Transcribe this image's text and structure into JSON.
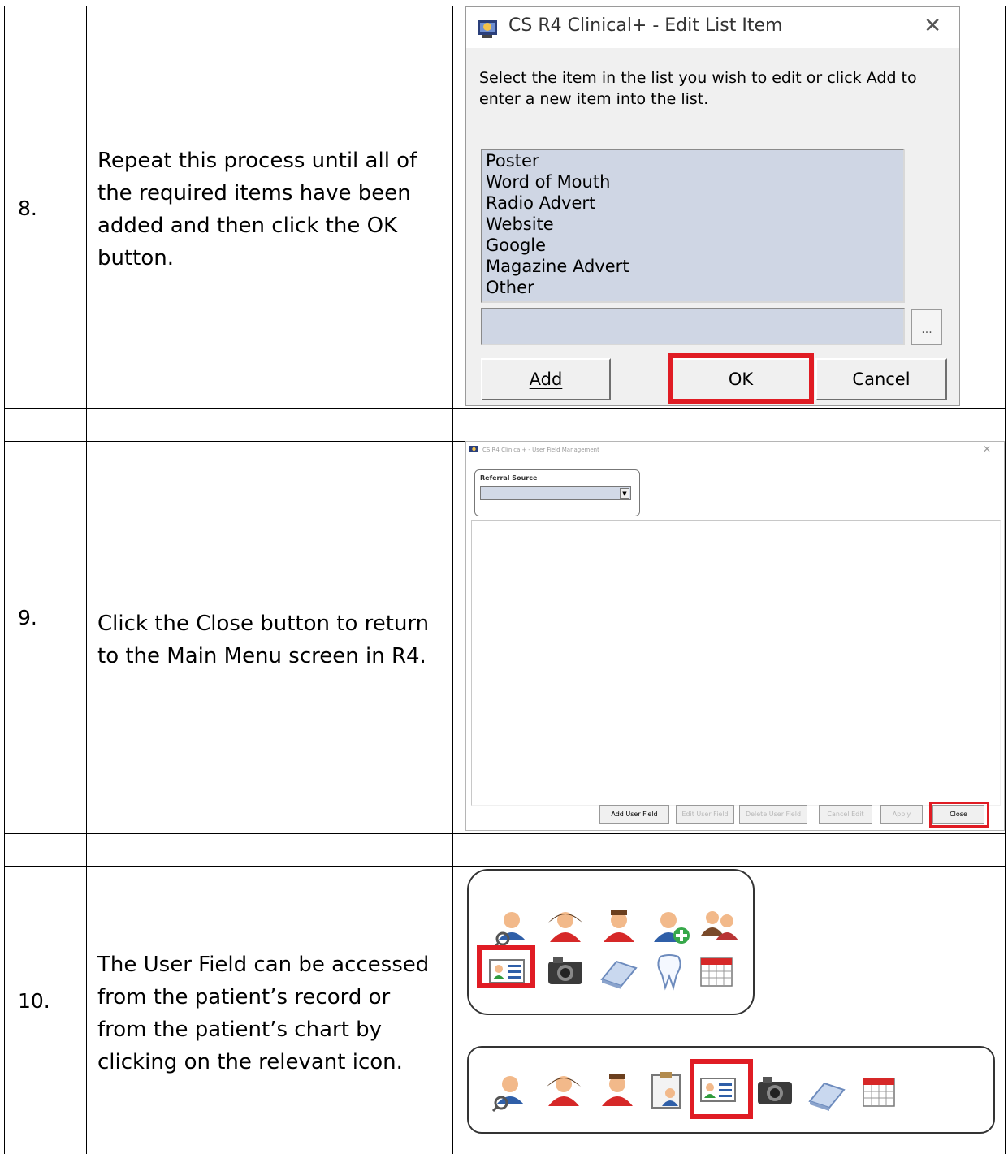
{
  "steps": [
    {
      "num": "8.",
      "text": "Repeat this process until all of the required items have been added and then click the OK button."
    },
    {
      "num": "9.",
      "text": "Click the Close button to return to the Main Menu screen in R4."
    },
    {
      "num": "10.",
      "text": "The User Field can be accessed from the patient’s record or from the patient’s chart by clicking on the relevant icon."
    }
  ],
  "edit_dialog": {
    "title": "CS R4 Clinical+ - Edit List Item",
    "message": "Select the item in the list you wish to edit or click Add to enter a new item into the list.",
    "list_items": [
      "Poster",
      "Word of Mouth",
      "Radio Advert",
      "Website",
      "Google",
      "Magazine Advert",
      "Other"
    ],
    "ellipsis_label": "...",
    "add_label": "Add",
    "ok_label": "OK",
    "cancel_label": "Cancel",
    "highlight_color": "#e01c24"
  },
  "user_field_window": {
    "title": "CS R4 Clinical+ - User Field Management",
    "group_label": "Referral Source",
    "buttons": {
      "add": "Add User Field",
      "edit": "Edit User Field",
      "delete": "Delete User Field",
      "cancel_edit": "Cancel Edit",
      "apply": "Apply",
      "close": "Close"
    }
  },
  "toolbar_icons": {
    "record_toolbar": [
      "patient-search-icon",
      "patient-red-icon",
      "patient-red-icon-2",
      "patient-add-icon",
      "family-icon",
      "user-field-icon",
      "camera-icon",
      "scanner-icon",
      "tooth-icon",
      "calendar-icon"
    ],
    "chart_toolbar": [
      "patient-search-icon",
      "patient-red-icon",
      "patient-red-icon-2",
      "clipboard-patient-icon",
      "user-field-icon",
      "camera-icon",
      "scanner-icon",
      "calendar-icon"
    ]
  }
}
